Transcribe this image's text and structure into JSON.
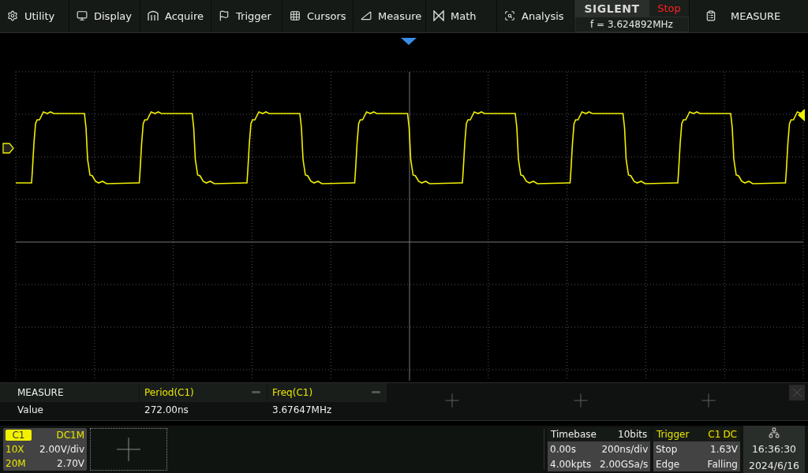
{
  "menu": [
    {
      "label": "Utility",
      "kind": "utility"
    },
    {
      "label": "Display",
      "kind": "display"
    },
    {
      "label": "Acquire",
      "kind": "acquire"
    },
    {
      "label": "Trigger",
      "kind": "trigger"
    },
    {
      "label": "Cursors",
      "kind": "cursors"
    },
    {
      "label": "Measure",
      "kind": "measure"
    },
    {
      "label": "Math",
      "kind": "math"
    },
    {
      "label": "Analysis",
      "kind": "analysis"
    }
  ],
  "brand": "SIGLENT",
  "run_state": "Stop",
  "frequency": "f = 3.624892MHz",
  "panel_button": "MEASURE",
  "measure": {
    "title": "MEASURE",
    "row_label": "Value",
    "items": [
      {
        "name": "Period(C1)",
        "value": "272.00ns"
      },
      {
        "name": "Freq(C1)",
        "value": "3.67647MHz"
      }
    ]
  },
  "channel": {
    "name": "C1",
    "coupling": "DC1M",
    "probe": "10X",
    "scale": "2.00V/div",
    "bandwidth": "20M",
    "offset": "2.70V"
  },
  "timebase": {
    "title": "Timebase",
    "bits": "10bits",
    "delay": "0.00s",
    "scale": "200ns/div",
    "points": "4.00kpts",
    "rate": "2.00GSa/s"
  },
  "trigger": {
    "title": "Trigger",
    "source": "C1",
    "coupling": "DC",
    "state": "Stop",
    "level": "1.63V",
    "type": "Edge",
    "slope": "Falling"
  },
  "clock": {
    "time": "16:36:30",
    "date": "2024/6/16"
  }
}
